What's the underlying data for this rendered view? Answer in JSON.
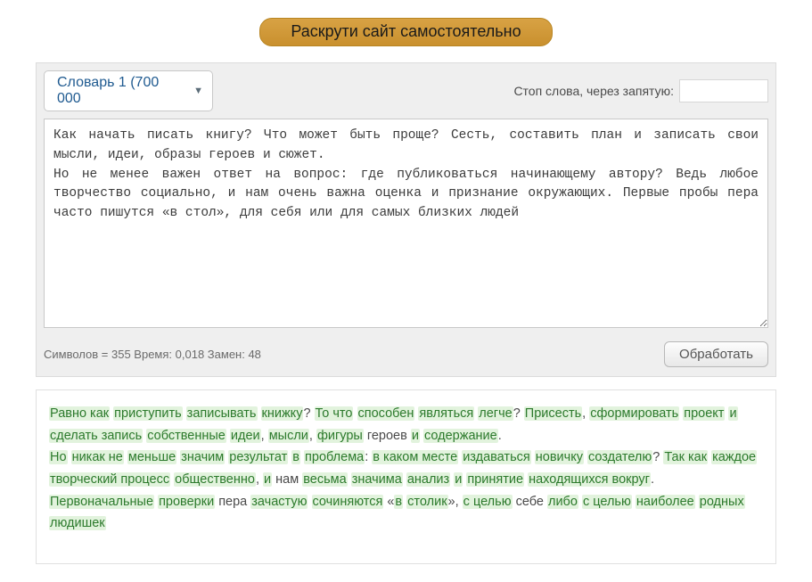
{
  "banner": {
    "label": "Раскрути сайт самостоятельно"
  },
  "controls": {
    "dictionary_selected": "Словарь 1 (700 000",
    "stop_words_label": "Стоп слова, через запятую:",
    "stop_words_value": ""
  },
  "source_text": "Как начать писать книгу? Что может быть проще? Сесть, составить план и записать свои мысли, идеи, образы героев и сюжет.\nНо не менее важен ответ на вопрос: где публиковаться начинающему автору? Ведь любое творчество социально, и нам очень важна оценка и признание окружающих. Первые пробы пера часто пишутся «в стол», для себя или для самых близких людей",
  "stats": {
    "chars_label": "Символов = ",
    "chars_value": "355",
    "time_label": "  Время: ",
    "time_value": "0,018",
    "replacements_label": "  Замен: ",
    "replacements_value": "48"
  },
  "process_button": "Обработать",
  "output_tokens": [
    {
      "t": "Равно как",
      "h": true
    },
    {
      "t": " ",
      "h": false
    },
    {
      "t": "приступить",
      "h": true
    },
    {
      "t": " ",
      "h": false
    },
    {
      "t": "записывать",
      "h": true
    },
    {
      "t": " ",
      "h": false
    },
    {
      "t": "книжку",
      "h": true
    },
    {
      "t": "? ",
      "h": false
    },
    {
      "t": "То что",
      "h": true
    },
    {
      "t": " ",
      "h": false
    },
    {
      "t": "способен",
      "h": true
    },
    {
      "t": " ",
      "h": false
    },
    {
      "t": "являться",
      "h": true
    },
    {
      "t": " ",
      "h": false
    },
    {
      "t": "легче",
      "h": true
    },
    {
      "t": "? ",
      "h": false
    },
    {
      "t": "Присесть",
      "h": true
    },
    {
      "t": ", ",
      "h": false
    },
    {
      "t": "сформировать",
      "h": true
    },
    {
      "t": " ",
      "h": false
    },
    {
      "t": "проект",
      "h": true
    },
    {
      "t": " ",
      "h": false
    },
    {
      "t": "и",
      "h": true
    },
    {
      "t": " ",
      "h": false
    },
    {
      "t": "сделать запись",
      "h": true
    },
    {
      "t": " ",
      "h": false
    },
    {
      "t": "собственные",
      "h": true
    },
    {
      "t": " ",
      "h": false
    },
    {
      "t": "идеи",
      "h": true
    },
    {
      "t": ", ",
      "h": false
    },
    {
      "t": "мысли",
      "h": true
    },
    {
      "t": ", ",
      "h": false
    },
    {
      "t": "фигуры",
      "h": true
    },
    {
      "t": " героев ",
      "h": false
    },
    {
      "t": "и",
      "h": true
    },
    {
      "t": " ",
      "h": false
    },
    {
      "t": "содержание",
      "h": true
    },
    {
      "t": ".",
      "h": false
    },
    {
      "t": "\n",
      "h": false
    },
    {
      "t": "Но",
      "h": true
    },
    {
      "t": " ",
      "h": false
    },
    {
      "t": "никак не",
      "h": true
    },
    {
      "t": " ",
      "h": false
    },
    {
      "t": "меньше",
      "h": true
    },
    {
      "t": " ",
      "h": false
    },
    {
      "t": "значим",
      "h": true
    },
    {
      "t": " ",
      "h": false
    },
    {
      "t": "результат",
      "h": true
    },
    {
      "t": " ",
      "h": false
    },
    {
      "t": "в",
      "h": true
    },
    {
      "t": " ",
      "h": false
    },
    {
      "t": "проблема",
      "h": true
    },
    {
      "t": ": ",
      "h": false
    },
    {
      "t": "в каком месте",
      "h": true
    },
    {
      "t": " ",
      "h": false
    },
    {
      "t": "издаваться",
      "h": true
    },
    {
      "t": " ",
      "h": false
    },
    {
      "t": "новичку",
      "h": true
    },
    {
      "t": " ",
      "h": false
    },
    {
      "t": "создателю",
      "h": true
    },
    {
      "t": "? ",
      "h": false
    },
    {
      "t": "Так как",
      "h": true
    },
    {
      "t": " ",
      "h": false
    },
    {
      "t": "каждое",
      "h": true
    },
    {
      "t": " ",
      "h": false
    },
    {
      "t": "творческий процесс",
      "h": true
    },
    {
      "t": " ",
      "h": false
    },
    {
      "t": "общественно",
      "h": true
    },
    {
      "t": ", ",
      "h": false
    },
    {
      "t": "и",
      "h": true
    },
    {
      "t": " нам ",
      "h": false
    },
    {
      "t": "весьма",
      "h": true
    },
    {
      "t": " ",
      "h": false
    },
    {
      "t": "значима",
      "h": true
    },
    {
      "t": " ",
      "h": false
    },
    {
      "t": "анализ",
      "h": true
    },
    {
      "t": " ",
      "h": false
    },
    {
      "t": "и",
      "h": true
    },
    {
      "t": " ",
      "h": false
    },
    {
      "t": "принятие",
      "h": true
    },
    {
      "t": " ",
      "h": false
    },
    {
      "t": "находящихся вокруг",
      "h": true
    },
    {
      "t": ". ",
      "h": false
    },
    {
      "t": "Первоначальные",
      "h": true
    },
    {
      "t": " ",
      "h": false
    },
    {
      "t": "проверки",
      "h": true
    },
    {
      "t": " пера ",
      "h": false
    },
    {
      "t": "зачастую",
      "h": true
    },
    {
      "t": " ",
      "h": false
    },
    {
      "t": "сочиняются",
      "h": true
    },
    {
      "t": " «",
      "h": false
    },
    {
      "t": "в",
      "h": true
    },
    {
      "t": " ",
      "h": false
    },
    {
      "t": "столик",
      "h": true
    },
    {
      "t": "», ",
      "h": false
    },
    {
      "t": "с целью",
      "h": true
    },
    {
      "t": " себе ",
      "h": false
    },
    {
      "t": "либо",
      "h": true
    },
    {
      "t": " ",
      "h": false
    },
    {
      "t": "с целью",
      "h": true
    },
    {
      "t": " ",
      "h": false
    },
    {
      "t": "наиболее",
      "h": true
    },
    {
      "t": " ",
      "h": false
    },
    {
      "t": "родных",
      "h": true
    },
    {
      "t": " ",
      "h": false
    },
    {
      "t": "людишек",
      "h": true
    }
  ]
}
